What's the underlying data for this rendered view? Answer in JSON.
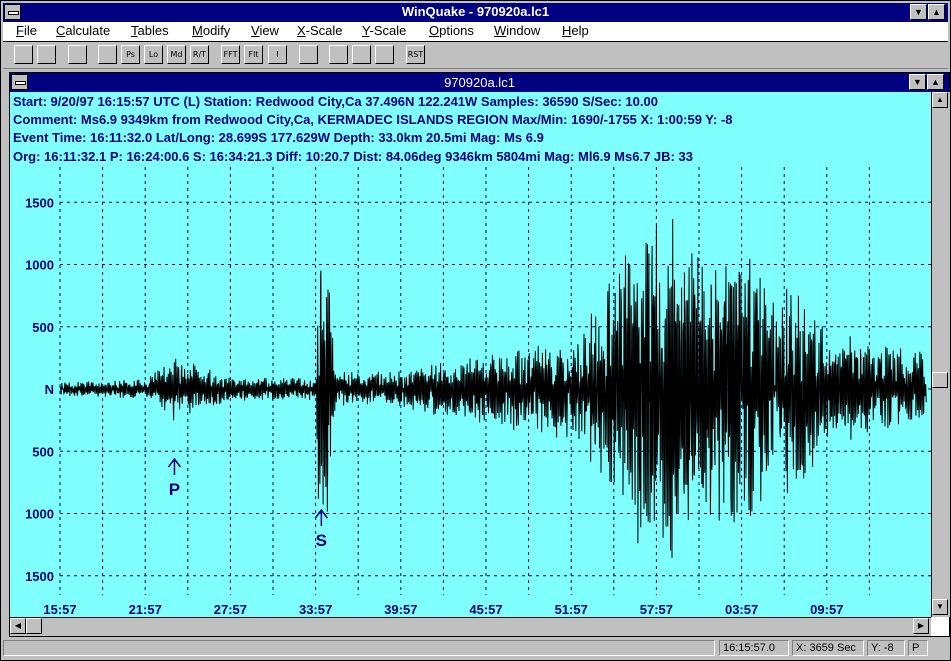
{
  "app": {
    "title": "WinQuake - 970920a.lc1"
  },
  "menu": [
    "File",
    "Calculate",
    "Tables",
    "Modify",
    "View",
    "X-Scale",
    "Y-Scale",
    "Options",
    "Window",
    "Help"
  ],
  "menu_mnemonics": [
    "F",
    "C",
    "T",
    "M",
    "V",
    "X",
    "Y",
    "O",
    "W",
    "H"
  ],
  "toolbar": {
    "icons": [
      "open-icon",
      "save-icon",
      "print-preview-icon",
      "save-disk-icon",
      "ps-icon",
      "loc-icon",
      "md-icon",
      "rt-icon",
      "fft-icon",
      "filter-icon",
      "integrate-icon",
      "copy-icon",
      "bars1-icon",
      "bars2-icon",
      "bars3-icon",
      "reset-icon"
    ],
    "labels": [
      "",
      "",
      "",
      "",
      "Ps",
      "Lo",
      "Md",
      "R/T",
      "FFT",
      "Flt",
      "I",
      "",
      "",
      "",
      "",
      "RST"
    ]
  },
  "child": {
    "title": "970920a.lc1"
  },
  "info": {
    "line1": "Start: 9/20/97 16:15:57 UTC (L) Station: Redwood City,Ca 37.496N 122.241W Samples: 36590  S/Sec: 10.00",
    "line2": "Comment: Ms6.9 9349km from Redwood City,Ca, KERMADEC ISLANDS REGION  Max/Min: 1690/-1755 X: 1:00:59 Y: -8",
    "line3": "Event Time: 16:11:32.0 Lat/Long: 28.699S 177.629W Depth: 33.0km 20.5mi Mag: Ms 6.9",
    "line4": "Org: 16:11:32.1 P: 16:24:00.6 S: 16:34:21.3 Diff: 10:20.7 Dist: 84.06deg 9346km 5804mi  Mag: Ml6.9 Ms6.7 JB: 33"
  },
  "chart_data": {
    "type": "line",
    "y_tick_labels": [
      "1500",
      "1000",
      "500",
      "N",
      "500",
      "1000",
      "1500"
    ],
    "y_tick_values": [
      1500,
      1000,
      500,
      0,
      -500,
      -1000,
      -1500
    ],
    "x_tick_labels": [
      "15:57",
      "21:57",
      "27:57",
      "33:57",
      "39:57",
      "45:57",
      "51:57",
      "57:57",
      "03:57",
      "09:57"
    ],
    "ylim": [
      -1755,
      1690
    ],
    "grid": true,
    "trace_color": "#000000",
    "background": "#80ffff",
    "grid_color": "#000080",
    "markers": [
      {
        "label": "P",
        "time": "16:24:00.6"
      },
      {
        "label": "S",
        "time": "16:34:21.3"
      }
    ],
    "envelope_segments_minutes_amplitude": [
      [
        0,
        60
      ],
      [
        6,
        80
      ],
      [
        8,
        260
      ],
      [
        10,
        180
      ],
      [
        12,
        100
      ],
      [
        18.0,
        90
      ],
      [
        18.3,
        1400
      ],
      [
        18.8,
        1100
      ],
      [
        19.5,
        140
      ],
      [
        24,
        150
      ],
      [
        30,
        300
      ],
      [
        36,
        420
      ],
      [
        38,
        700
      ],
      [
        40,
        1200
      ],
      [
        42,
        1550
      ],
      [
        45,
        1100
      ],
      [
        48,
        1200
      ],
      [
        50,
        900
      ],
      [
        52,
        800
      ],
      [
        54,
        500
      ],
      [
        57,
        400
      ],
      [
        61,
        300
      ]
    ]
  },
  "statusbar": {
    "time": "16:15:57.0",
    "x": "X: 3659 Sec",
    "y": "Y: -8",
    "mode": "P"
  }
}
